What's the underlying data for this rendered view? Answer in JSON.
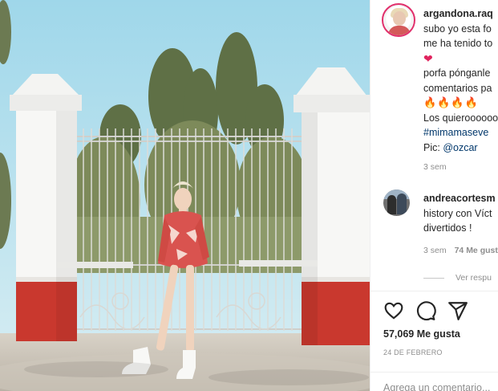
{
  "post": {
    "username": "argandona.raq",
    "caption_lines": [
      "subo yo esta fo",
      "me ha tenido to"
    ],
    "caption_line3": "porfa pónganle",
    "caption_line4": "comentarios pa",
    "emoji_fire": "🔥🔥🔥🔥",
    "heart_emoji": "❤",
    "caption_line5": "Los quieroooooo",
    "hashtag": "#mimamaseve",
    "pic_label": "Pic: ",
    "mention": "@ozcar",
    "time_ago": "3 sem"
  },
  "reply": {
    "username": "andreacortesm",
    "text_line1": "history con Víct",
    "text_line2": "divertidos !",
    "time_ago": "3 sem",
    "likes": "74 Me gust",
    "view_replies": "Ver respu"
  },
  "footer": {
    "likes_count": "57,069 Me gusta",
    "date": "24 DE FEBRERO",
    "comment_placeholder": "Agrega un comentario..."
  },
  "icons": {
    "like": "heart-outline",
    "comment": "speech-bubble",
    "share": "paper-plane"
  },
  "colors": {
    "link": "#00376b",
    "muted": "#8e8e8e",
    "text": "#262626",
    "sky": "#bfe3f0",
    "dress": "#d9534f"
  }
}
